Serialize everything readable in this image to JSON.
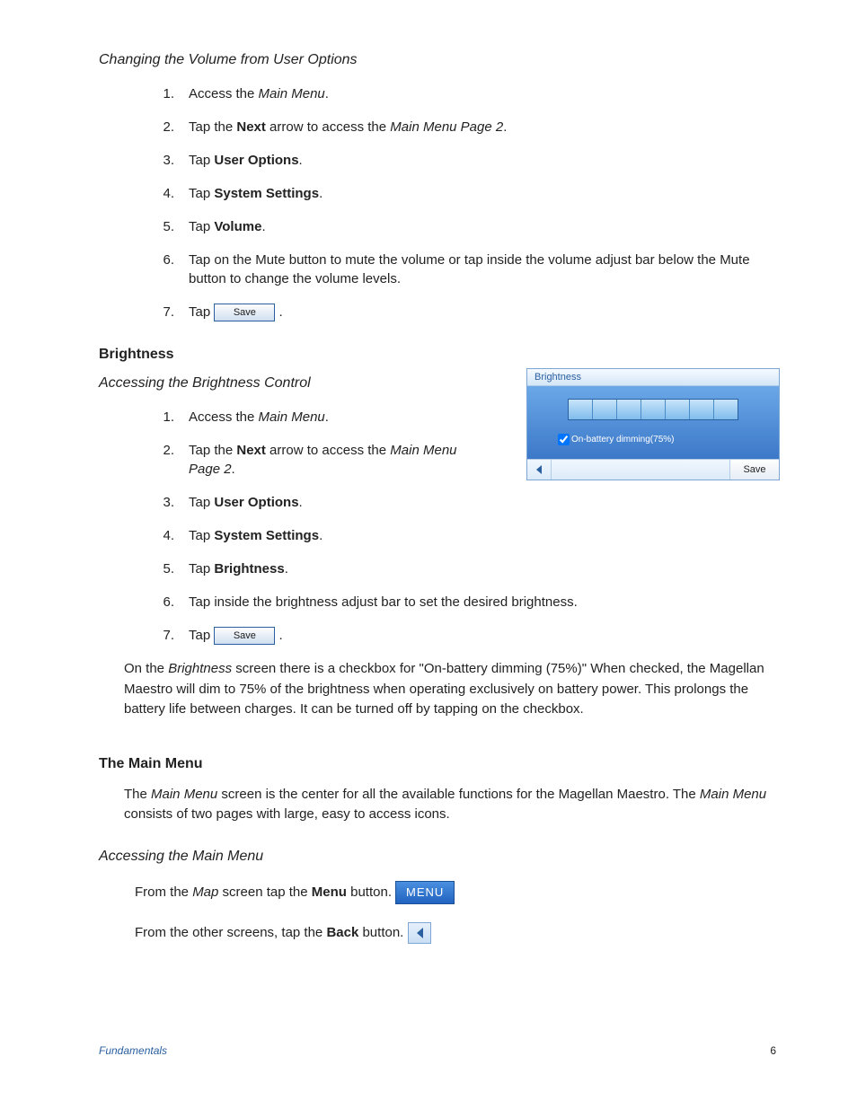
{
  "sec1": {
    "heading": "Changing the Volume from User Options",
    "items": [
      {
        "n": "1.",
        "pre": "Access the ",
        "i": "Main Menu",
        "post": "."
      },
      {
        "n": "2.",
        "pre": "Tap the ",
        "b": "Next",
        "post": " arrow to access the ",
        "i": "Main Menu Page 2",
        "post2": "."
      },
      {
        "n": "3.",
        "pre": "Tap ",
        "b": "User Options",
        "post": "."
      },
      {
        "n": "4.",
        "pre": "Tap ",
        "b": "System Settings",
        "post": "."
      },
      {
        "n": "5.",
        "pre": "Tap ",
        "b": "Volume",
        "post": "."
      },
      {
        "n": "6.",
        "pre": "Tap on the Mute button to mute the volume or tap inside the volume adjust bar below the Mute button to change the volume levels."
      },
      {
        "n": "7.",
        "pre": "Tap ",
        "btn": "Save",
        "post": "."
      }
    ]
  },
  "sec2": {
    "heading": "Brightness",
    "sub": "Accessing the Brightness Control",
    "items": [
      {
        "n": "1.",
        "pre": "Access the ",
        "i": "Main Menu",
        "post": "."
      },
      {
        "n": "2.",
        "pre": "Tap the ",
        "b": "Next",
        "post": " arrow to access the ",
        "i": "Main Menu Page 2",
        "post2": "."
      },
      {
        "n": "3.",
        "pre": "Tap ",
        "b": "User Options",
        "post": "."
      },
      {
        "n": "4.",
        "pre": "Tap ",
        "b": "System Settings",
        "post": "."
      },
      {
        "n": "5.",
        "pre": "Tap ",
        "b": "Brightness",
        "post": "."
      },
      {
        "n": "6.",
        "pre": "Tap inside the brightness adjust bar to set the desired brightness."
      },
      {
        "n": "7.",
        "pre": "Tap ",
        "btn": "Save",
        "post": "."
      }
    ],
    "panel": {
      "title": "Brightness",
      "checkbox": "On-battery dimming(75%)",
      "save": "Save"
    },
    "para": {
      "p1": "On the ",
      "i1": "Brightness",
      "p2": " screen there is a checkbox for \"On-battery dimming (75%)\"  When checked, the Magellan Maestro will dim to 75% of the brightness when operating exclusively on battery power. This prolongs the battery life between charges.  It can be turned off by tapping on the checkbox."
    }
  },
  "sec3": {
    "heading": "The Main Menu",
    "para": {
      "p1": "The ",
      "i1": "Main Menu",
      "p2": " screen is the center for all the available functions for the Magellan Maestro.  The ",
      "i2": "Main Menu",
      "p3": " consists of two pages with large, easy to access icons."
    },
    "sub": "Accessing the Main Menu",
    "line1": {
      "p1": "From the ",
      "i": "Map",
      "p2": " screen tap the ",
      "b": "Menu",
      "p3": " button. ",
      "btn": "MENU"
    },
    "line2": {
      "p1": "From the other screens, tap the ",
      "b": "Back",
      "p2": " button.  "
    }
  },
  "footer": {
    "left": "Fundamentals",
    "right": "6"
  }
}
